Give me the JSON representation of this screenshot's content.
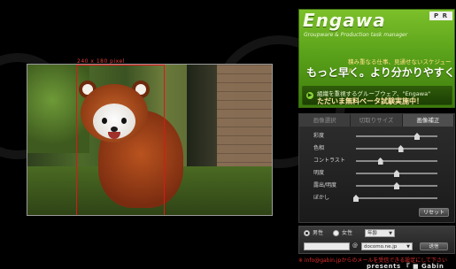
{
  "photo": {
    "selection_label": "240 x 180 pixel"
  },
  "ad": {
    "brand": "Engawa",
    "subtitle": "Groupware & Production task manager",
    "pr_badge": "P R",
    "tagline": "積み重なる仕事、見通せないスケジュール",
    "headline": "もっと早く。より分かりやすく。",
    "cta_line1": "組織を重視するグループウェア、\"Engawa\"",
    "cta_line2": "ただいま無料ベータ試験実施中！",
    "colors": {
      "bg": "#5aa21a",
      "accent": "#ffe8a6"
    }
  },
  "panel": {
    "tabs": [
      {
        "label": "画像選択",
        "active": false
      },
      {
        "label": "切取りサイズ",
        "active": false
      },
      {
        "label": "画像補正",
        "active": true
      }
    ],
    "sliders": [
      {
        "label": "彩度",
        "value": 0.75
      },
      {
        "label": "色相",
        "value": 0.55
      },
      {
        "label": "コントラスト",
        "value": 0.3
      },
      {
        "label": "明度",
        "value": 0.5
      },
      {
        "label": "露出/明度",
        "value": 0.5
      },
      {
        "label": "ぼかし",
        "value": 0.0
      }
    ],
    "reset_label": "リセット"
  },
  "form": {
    "gender_male": "男性",
    "gender_female": "女性",
    "selected_gender": "male",
    "age_select": "年齢",
    "email_placeholder": "",
    "at": "@",
    "domain_select": "docomo.ne.jp",
    "send_label": "送信"
  },
  "footer": {
    "note": "※ info@gabin.jpからのメールを受信できる設定にして下さい",
    "logo": "presents 『 ■ Gabin"
  }
}
